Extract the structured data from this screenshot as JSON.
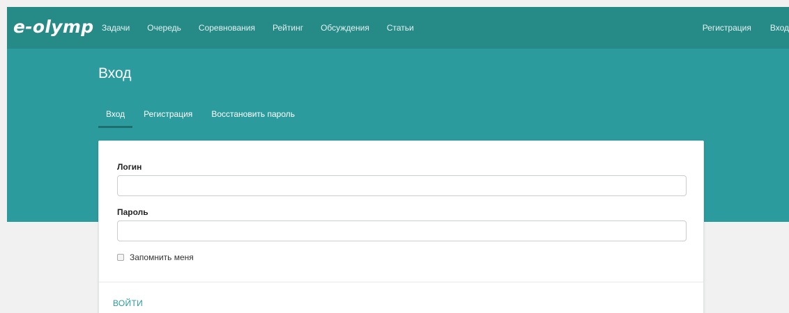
{
  "header": {
    "logo": "e-olymp",
    "nav": [
      {
        "label": "Задачи"
      },
      {
        "label": "Очередь"
      },
      {
        "label": "Соревнования"
      },
      {
        "label": "Рейтинг"
      },
      {
        "label": "Обсуждения"
      },
      {
        "label": "Статьи"
      }
    ],
    "right": [
      {
        "label": "Регистрация"
      },
      {
        "label": "Вход"
      }
    ]
  },
  "page": {
    "title": "Вход",
    "tabs": [
      {
        "label": "Вход",
        "active": true
      },
      {
        "label": "Регистрация",
        "active": false
      },
      {
        "label": "Восстановить пароль",
        "active": false
      }
    ]
  },
  "form": {
    "login_label": "Логин",
    "login_value": "",
    "password_label": "Пароль",
    "password_value": "",
    "remember_label": "Запомнить меня",
    "remember_checked": false,
    "submit_label": "ВОЙТИ"
  },
  "colors": {
    "topbar": "#268a87",
    "hero": "#2b9b9d",
    "accent": "#2b9b9d"
  }
}
